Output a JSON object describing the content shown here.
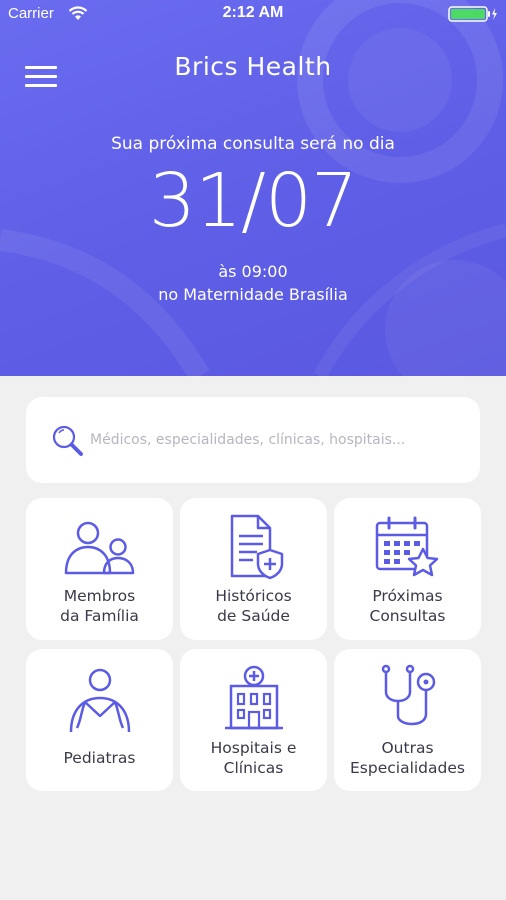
{
  "status_bar": {
    "carrier": "Carrier",
    "time": "2:12 AM"
  },
  "header": {
    "app_title": "Brics Health"
  },
  "appointment": {
    "label": "Sua próxima consulta será no dia",
    "date": "31/07",
    "time": "às 09:00",
    "place": "no Maternidade Brasília"
  },
  "search": {
    "placeholder": "Médicos, especialidades, clínicas, hospitais..."
  },
  "tiles": [
    {
      "line1": "Membros",
      "line2": "da Família",
      "icon": "family-icon"
    },
    {
      "line1": "Históricos",
      "line2": "de Saúde",
      "icon": "health-records-icon"
    },
    {
      "line1": "Próximas",
      "line2": "Consultas",
      "icon": "calendar-star-icon"
    },
    {
      "line1": "Pediatras",
      "line2": "",
      "icon": "pediatrician-icon"
    },
    {
      "line1": "Hospitais e",
      "line2": "Clínicas",
      "icon": "hospital-icon"
    },
    {
      "line1": "Outras",
      "line2": "Especialidades",
      "icon": "stethoscope-icon"
    }
  ],
  "colors": {
    "accent": "#5b5be6",
    "icon": "#5b5be6",
    "background": "#f0f0f0",
    "battery": "#4cd964"
  }
}
